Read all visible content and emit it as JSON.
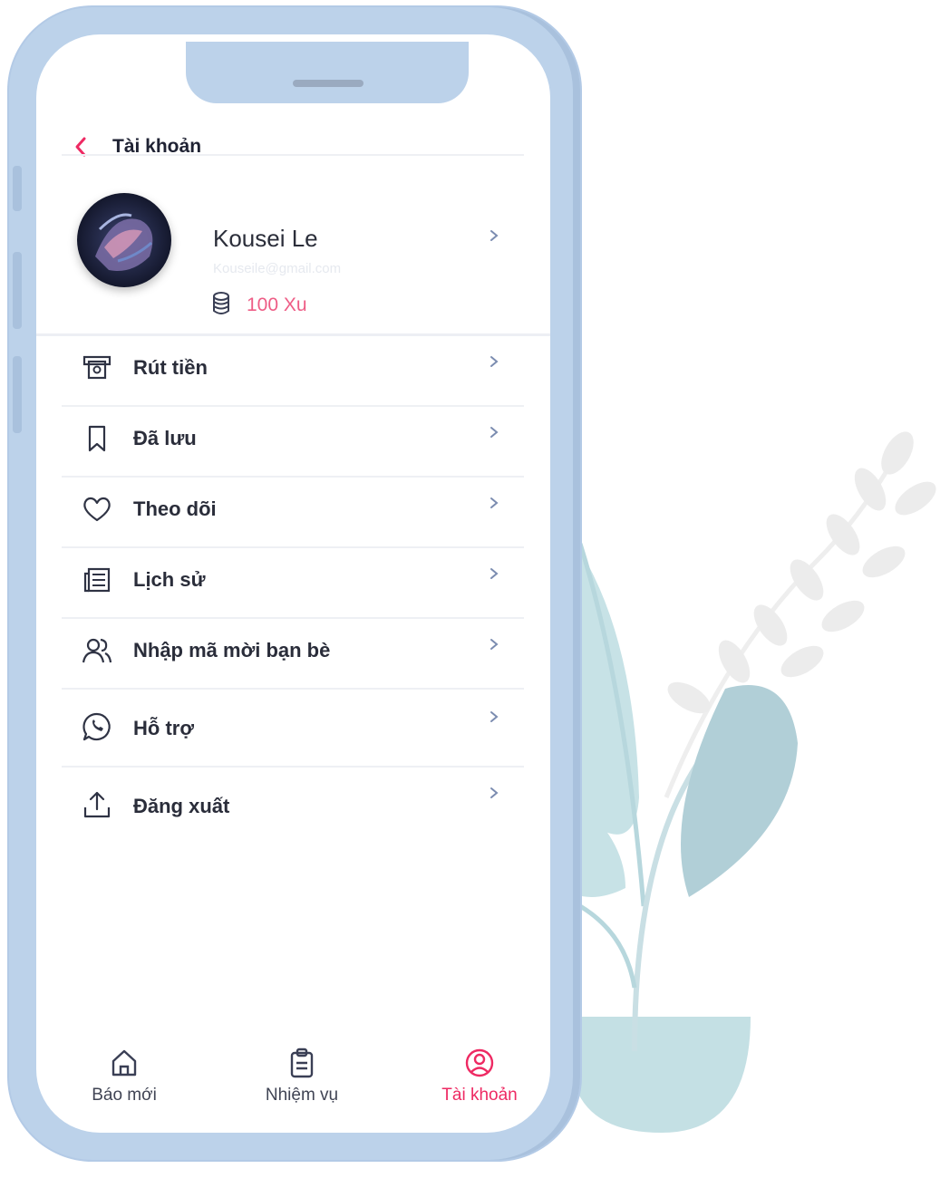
{
  "header": {
    "title": "Tài khoản"
  },
  "profile": {
    "name": "Kousei Le",
    "email": "Kouseile@gmail.com",
    "coins": "100 Xu"
  },
  "menu": [
    {
      "label": "Rút tiền",
      "icon": "atm-cash-icon"
    },
    {
      "label": "Đã lưu",
      "icon": "bookmark-icon"
    },
    {
      "label": "Theo dõi",
      "icon": "heart-icon"
    },
    {
      "label": "Lịch sử",
      "icon": "history-list-icon"
    },
    {
      "label": "Nhập mã mời bạn bè",
      "icon": "users-icon"
    },
    {
      "label": "Hỗ trợ",
      "icon": "whatsapp-support-icon"
    },
    {
      "label": "Đăng xuất",
      "icon": "upload-logout-icon"
    }
  ],
  "tabs": [
    {
      "label": "Báo mới",
      "icon": "home-icon",
      "active": false
    },
    {
      "label": "Nhiệm vụ",
      "icon": "clipboard-icon",
      "active": false
    },
    {
      "label": "Tài khoản",
      "icon": "user-circle-icon",
      "active": true
    }
  ],
  "colors": {
    "accent": "#ee2a63",
    "coin": "#ee5d86",
    "frame": "#bcd2ea",
    "plant": "#b5d6dc"
  }
}
